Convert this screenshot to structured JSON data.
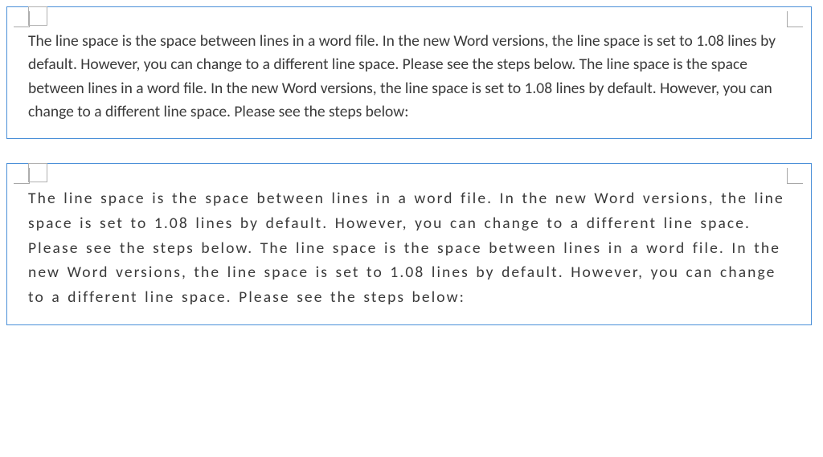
{
  "box1": {
    "text": "The line space is the space between lines in a word file. In the new Word versions, the line space is set to 1.08 lines by default. However, you can change to a different line space. Please see the steps below. The line space is the space between lines in a word file. In the new Word versions, the line space is set to 1.08 lines by default. However, you can change to a different line space. Please see the steps below:"
  },
  "box2": {
    "text": "The line space is the space between lines in a word file. In the new Word versions, the line space is set to 1.08 lines by default. However, you can change to a different line space. Please see the steps below. The line space is the space between lines in a word file. In the new Word versions, the line space is set to 1.08 lines by default. However, you can change to a different line space. Please see the steps below:"
  },
  "colors": {
    "border": "#4a8fd8",
    "text": "#3a3a3a",
    "cropmark": "#a8a8a8"
  }
}
